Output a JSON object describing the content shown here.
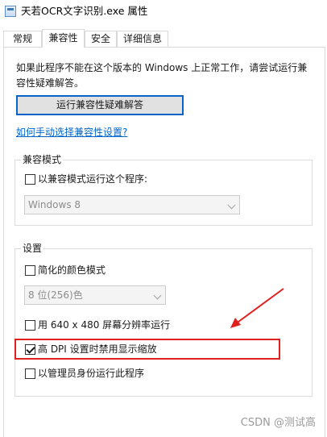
{
  "window": {
    "title": "天若OCR文字识别.exe 属性"
  },
  "tabs": [
    {
      "label": "常规"
    },
    {
      "label": "兼容性"
    },
    {
      "label": "安全"
    },
    {
      "label": "详细信息"
    }
  ],
  "active_tab": "兼容性",
  "description": "如果此程序不能在这个版本的 Windows 上正常工作，请尝试运行兼容性疑难解答。",
  "troubleshoot_button": "运行兼容性疑难解答",
  "manual_link": "如何手动选择兼容性设置?",
  "compat_mode": {
    "group_label": "兼容模式",
    "checkbox_label": "以兼容模式运行这个程序:",
    "checked": false,
    "select_value": "Windows 8"
  },
  "settings": {
    "group_label": "设置",
    "reduced_color": {
      "label": "简化的颜色模式",
      "checked": false
    },
    "color_select_value": "8 位(256)色",
    "res_640": {
      "label": "用 640 x 480 屏幕分辨率运行",
      "checked": false
    },
    "high_dpi": {
      "label": "高 DPI 设置时禁用显示缩放",
      "checked": true
    },
    "run_as_admin": {
      "label": "以管理员身份运行此程序",
      "checked": false
    }
  },
  "annotation": {
    "highlight_color": "#e0201e"
  },
  "watermark": "CSDN @测试高",
  "icons": {
    "app": "app-window-icon",
    "select_chevron": "chevron-down-icon",
    "arrow": "red-arrow-annotation"
  }
}
